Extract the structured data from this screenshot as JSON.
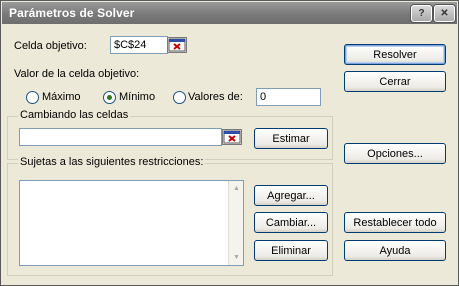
{
  "window": {
    "title": "Parámetros de Solver"
  },
  "target": {
    "label": "Celda objetivo:",
    "value": "$C$24"
  },
  "value_of": {
    "label": "Valor de la celda objetivo:",
    "options": {
      "max": "Máximo",
      "min": "Mínimo",
      "values": "Valores de:"
    },
    "selected": "Mínimo",
    "values_input": "0"
  },
  "changing": {
    "label": "Cambiando las celdas",
    "value": "",
    "guess_button": "Estimar"
  },
  "constraints": {
    "label": "Sujetas a las siguientes restricciones:",
    "items": [],
    "add_button": "Agregar...",
    "change_button": "Cambiar...",
    "delete_button": "Eliminar"
  },
  "buttons": {
    "solve": "Resolver",
    "close": "Cerrar",
    "options": "Opciones...",
    "reset": "Restablecer todo",
    "help": "Ayuda"
  },
  "titlebar": {
    "help_glyph": "?",
    "close_glyph": "✕"
  },
  "icons": {
    "range_select": "range-select-icon",
    "help": "help-icon",
    "close": "close-icon"
  }
}
